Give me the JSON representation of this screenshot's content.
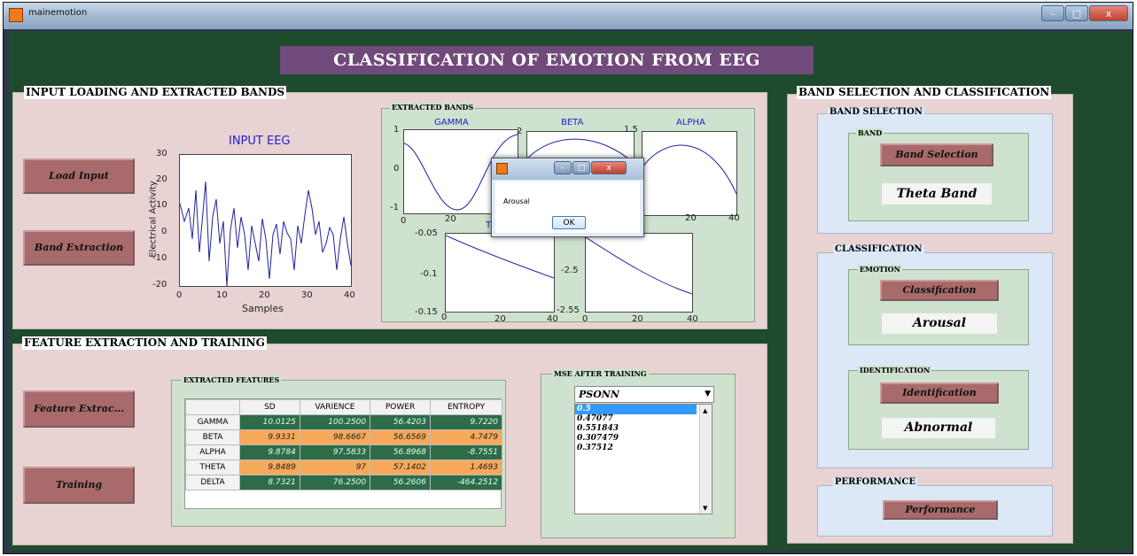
{
  "window": {
    "title": "mainemotion",
    "controls": [
      "–",
      "□",
      "x"
    ]
  },
  "main_title": "CLASSIFICATION OF EMOTION FROM EEG",
  "input_section": {
    "title": "INPUT LOADING AND EXTRACTED BANDS",
    "load_input_label": "Load Input",
    "band_extraction_label": "Band Extraction"
  },
  "input_plot": {
    "title": "INPUT EEG",
    "xlabel": "Samples",
    "ylabel": "Electrical Activity",
    "x_ticks": [
      "0",
      "10",
      "20",
      "30",
      "40"
    ],
    "y_ticks": [
      "30",
      "20",
      "10",
      "0",
      "-10",
      "-20"
    ]
  },
  "extracted_bands": {
    "title": "EXTRACTED BANDS",
    "plots": [
      {
        "title": "GAMMA",
        "y_ticks": [
          "1",
          "0",
          "-1"
        ],
        "x_ticks": [
          "0",
          "20"
        ]
      },
      {
        "title": "BETA",
        "y_ticks": [
          "2"
        ]
      },
      {
        "title": "ALPHA",
        "y_ticks": [
          "1.5"
        ],
        "x_ticks": [
          "20",
          "40"
        ]
      },
      {
        "title": "T",
        "y_ticks": [
          "-0.05",
          "-0.1",
          "-0.15"
        ],
        "x_ticks": [
          "0",
          "20",
          "40"
        ]
      },
      {
        "title": "",
        "y_ticks": [
          "-2.5",
          "-2.55"
        ],
        "x_ticks": [
          "0",
          "20",
          "40"
        ]
      }
    ]
  },
  "band_section": {
    "title": "BAND SELECTION AND CLASSIFICATION",
    "band_selection_title": "BAND SELECTION",
    "band_group_title": "BAND",
    "band_selection_button": "Band Selection",
    "band_value": "Theta Band",
    "classification_title": "CLASSIFICATION",
    "emotion_group_title": "EMOTION",
    "classification_button": "Classification",
    "emotion_value": "Arousal",
    "identification_group_title": "IDENTIFICATION",
    "identification_button": "Identification",
    "identification_value": "Abnormal",
    "performance_title": "PERFORMANCE",
    "performance_button": "Performance"
  },
  "feature_section": {
    "title": "FEATURE EXTRACTION AND TRAINING",
    "feature_extraction_label": "Feature Extrac...",
    "training_label": "Training",
    "table_title": "EXTRACTED FEATURES",
    "columns": [
      "SD",
      "VARIENCE",
      "POWER",
      "ENTROPY"
    ],
    "rows": [
      {
        "name": "GAMMA",
        "values": [
          "10.0125",
          "100.2500",
          "56.4203",
          "9.7220"
        ]
      },
      {
        "name": "BETA",
        "values": [
          "9.9331",
          "98.6667",
          "56.6569",
          "4.7479"
        ]
      },
      {
        "name": "ALPHA",
        "values": [
          "9.8784",
          "97.5833",
          "56.8968",
          "-8.7551"
        ]
      },
      {
        "name": "THETA",
        "values": [
          "9.8489",
          "97",
          "57.1402",
          "1.4693"
        ]
      },
      {
        "name": "DELTA",
        "values": [
          "8.7321",
          "76.2500",
          "56.2606",
          "-464.2512"
        ]
      }
    ],
    "row_colors": [
      "#2e6b49",
      "#f6a95a",
      "#2e6b49",
      "#f6a95a",
      "#2e6b49"
    ]
  },
  "mse_section": {
    "title": "MSE AFTER TRAINING",
    "dropdown_value": "PSONN",
    "list_items": [
      "0.5",
      "0.47077",
      "0.551843",
      "0.307479",
      "0.37512"
    ]
  },
  "dialog": {
    "message": "Arousal",
    "ok_label": "OK"
  }
}
